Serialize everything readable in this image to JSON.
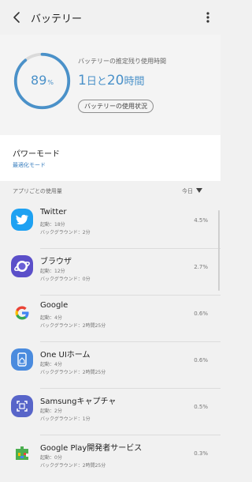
{
  "header": {
    "title": "バッテリー"
  },
  "battery": {
    "percent": "89",
    "percent_unit": "%",
    "level": 0.89,
    "estimate_label": "バッテリーの推定残り使用時間",
    "time_days": "1",
    "time_day_unit": "日と",
    "time_hours": "20",
    "time_hour_unit": "時間",
    "status_button": "バッテリーの使用状況",
    "ring_color": "#4a91c9"
  },
  "power_mode": {
    "title": "パワーモード",
    "value": "最適化モード",
    "value_color": "#3a7fbf"
  },
  "usage": {
    "label": "アプリごとの使用量",
    "period": "今日"
  },
  "apps": [
    {
      "name": "Twitter",
      "foreground": "起動：18分",
      "background": "バックグラウンド：2分",
      "percent": "4.5%",
      "icon": "twitter-icon"
    },
    {
      "name": "ブラウザ",
      "foreground": "起動：12分",
      "background": "バックグラウンド：0分",
      "percent": "2.7%",
      "icon": "samsung-internet-icon"
    },
    {
      "name": "Google",
      "foreground": "起動：4分",
      "background": "バックグラウンド：2時間25分",
      "percent": "0.6%",
      "icon": "google-icon"
    },
    {
      "name": "One UIホーム",
      "foreground": "起動：4分",
      "background": "バックグラウンド：2時間25分",
      "percent": "0.6%",
      "icon": "one-ui-home-icon"
    },
    {
      "name": "Samsungキャプチャ",
      "foreground": "起動：2分",
      "background": "バックグラウンド：1分",
      "percent": "0.5%",
      "icon": "samsung-capture-icon"
    },
    {
      "name": "Google Play開発者サービス",
      "foreground": "起動：0分",
      "background": "バックグラウンド：2時間25分",
      "percent": "0.3%",
      "icon": "google-play-services-icon"
    }
  ]
}
